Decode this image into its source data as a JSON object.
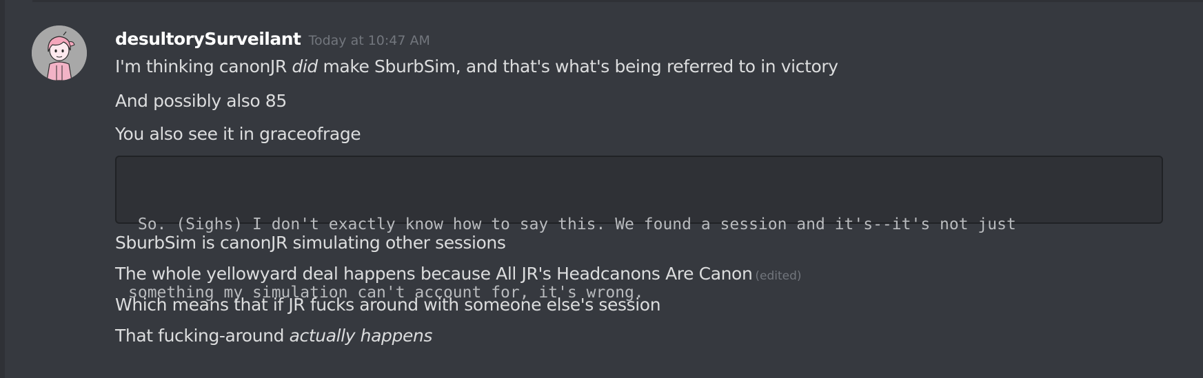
{
  "message": {
    "username": "desultorySurveilant",
    "timestamp": "Today at 10:47 AM",
    "lines": [
      {
        "pre": "I'm thinking canonJR ",
        "em": "did",
        "post": " make SburbSim, and that's what's being referred to in victory"
      },
      {
        "text": "And possibly also 85"
      },
      {
        "text": "You also see it in graceofrage"
      },
      {
        "text": "SburbSim is canonJR simulating other sessions"
      },
      {
        "text": "The whole yellowyard deal happens because All JR's Headcanons Are Canon",
        "edited": "(edited)"
      },
      {
        "text": "Which means that if JR fucks around with someone else's session"
      },
      {
        "pre": "That fucking-around ",
        "em": "actually happens"
      }
    ],
    "codeblock": {
      "line1": " So. (Sighs) I don't exactly know how to say this. We found a session and it's--it's not just",
      "line2": "something my simulation can't account for, it's wrong."
    }
  },
  "colors": {
    "background": "#36393f",
    "username": "#ffffff",
    "text": "#dcddde",
    "timestamp": "#72767d",
    "code_bg": "#2f3136"
  },
  "icons": {
    "avatar": "pink-haired-character-avatar"
  }
}
